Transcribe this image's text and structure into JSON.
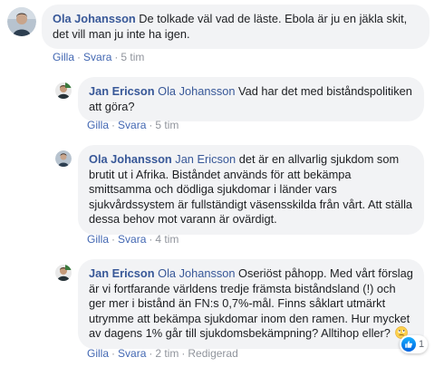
{
  "comments": [
    {
      "author": "Ola Johansson",
      "mention": "",
      "text": "De tolkade väl vad de läste. Ebola är ju en jäkla skit, det vill man ju inte ha igen.",
      "actions": {
        "like": "Gilla",
        "reply": "Svara",
        "time": "5 tim",
        "edited": ""
      }
    },
    {
      "author": "Jan Ericson",
      "mention": "Ola Johansson",
      "text": "Vad har det med biståndspolitiken att göra?",
      "actions": {
        "like": "Gilla",
        "reply": "Svara",
        "time": "5 tim",
        "edited": ""
      }
    },
    {
      "author": "Ola Johansson",
      "mention": "Jan Ericson",
      "text": "det är en allvarlig sjukdom som brutit ut i Afrika. Biståndet används för att bekämpa smittsamma och dödliga sjukdomar i länder vars sjukvårdssystem är fullständigt väsensskilda från vårt. Att ställa dessa behov mot varann är ovärdigt.",
      "actions": {
        "like": "Gilla",
        "reply": "Svara",
        "time": "4 tim",
        "edited": ""
      }
    },
    {
      "author": "Jan Ericson",
      "mention": "Ola Johansson",
      "text": "Oseriöst påhopp. Med vårt förslag är vi fortfarande världens tredje främsta biståndsland (!) och ger mer i bistånd än FN:s 0,7%-mål. Finns såklart utmärkt utrymme att bekämpa sjukdomar inom den ramen. Hur mycket av dagens 1% går till sjukdomsbekämpning? Alltihop eller?",
      "emoji": "confused-face-icon",
      "actions": {
        "like": "Gilla",
        "reply": "Svara",
        "time": "2 tim",
        "edited": "Redigerad"
      },
      "reaction_count": "1"
    }
  ],
  "colors": {
    "name": "#385898",
    "link": "#4267b2",
    "meta": "#90949c",
    "bubble": "#f2f3f5",
    "like": "#0062df"
  }
}
